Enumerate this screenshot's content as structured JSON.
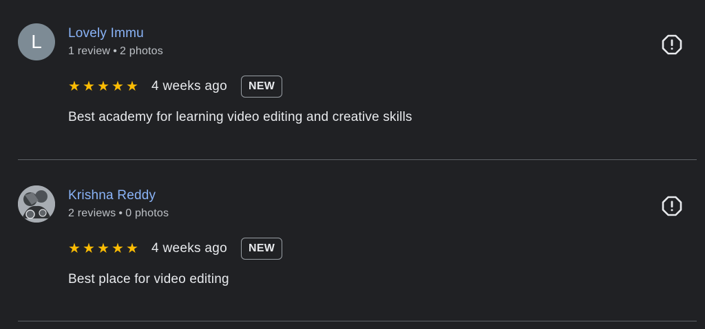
{
  "colors": {
    "background": "#202124",
    "name": "#8ab4f8",
    "star": "#fbbc04",
    "avatar_letter_bg": "#7d8b95"
  },
  "reviews": [
    {
      "avatar_letter": "L",
      "name": "Lovely Immu",
      "review_count": "1 review",
      "separator": "•",
      "photo_count": "2 photos",
      "stars": [
        "★",
        "★",
        "★",
        "★",
        "★"
      ],
      "rating": 5,
      "date": "4 weeks ago",
      "badge": "NEW",
      "text": "Best academy for learning video editing and creative skills",
      "report_icon": "report-icon"
    },
    {
      "avatar_letter": "",
      "avatar_icon": "profile-photo",
      "name": "Krishna Reddy",
      "review_count": "2 reviews",
      "separator": "•",
      "photo_count": "0 photos",
      "stars": [
        "★",
        "★",
        "★",
        "★",
        "★"
      ],
      "rating": 5,
      "date": "4 weeks ago",
      "badge": "NEW",
      "text": "Best place for video editing",
      "report_icon": "report-icon"
    }
  ]
}
